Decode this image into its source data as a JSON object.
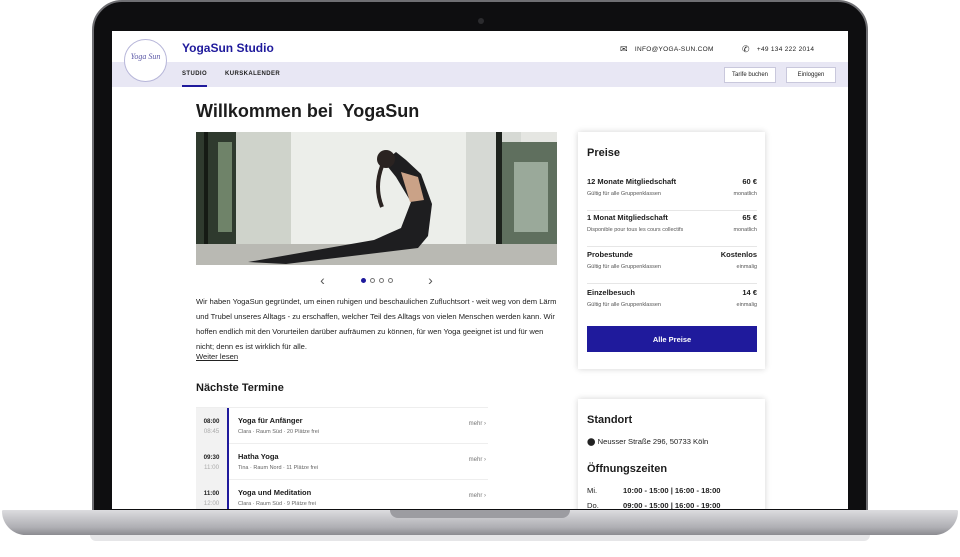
{
  "header": {
    "logo_text": "Yoga Sun",
    "brand": "YogaSun Studio",
    "email": "INFO@YOGA-SUN.COM",
    "phone": "+49 134 222 2014"
  },
  "nav": {
    "links": [
      "STUDIO",
      "KURSKALENDER"
    ],
    "btn_tarife": "Tarife buchen",
    "btn_login": "Einloggen"
  },
  "main": {
    "title": "Willkommen bei  YogaSun",
    "intro": "Wir haben YogaSun gegründet, um einen ruhigen und beschaulichen Zufluchtsort - weit weg von dem Lärm und Trubel unseres Alltags - zu erschaffen, welcher Teil des Alltags von vielen Menschen werden kann. Wir hoffen endlich mit den Vorurteilen darüber aufräumen zu können, für wen Yoga geeignet ist und für wen nicht; denn es ist wirklich für alle.",
    "read_more": "Weiter lesen",
    "carousel": {
      "slides": 4,
      "active": 1
    }
  },
  "schedule": {
    "title": "Nächste Termine",
    "more_label": "mehr",
    "items": [
      {
        "start": "08:00",
        "end": "08:45",
        "name": "Yoga für Anfänger",
        "desc": "Clara · Raum Süd · 20 Plätze frei"
      },
      {
        "start": "09:30",
        "end": "11:00",
        "name": "Hatha Yoga",
        "desc": "Tina · Raum Nord · 11 Plätze frei"
      },
      {
        "start": "11:00",
        "end": "12:00",
        "name": "Yoga und Meditation",
        "desc": "Clara · Raum Süd · 9 Plätze frei"
      }
    ]
  },
  "prices": {
    "title": "Preise",
    "items": [
      {
        "name": "12 Monate Mitgliedschaft",
        "value": "60 €",
        "note": "Gültig für alle Gruppenklassen",
        "period": "monatlich"
      },
      {
        "name": "1 Monat Mitgliedschaft",
        "value": "65 €",
        "note": "Disponible pour tous les cours collectifs",
        "period": "monatlich"
      },
      {
        "name": "Probestunde",
        "value": "Kostenlos",
        "note": "Gültig für alle Gruppenklassen",
        "period": "einmalig"
      },
      {
        "name": "Einzelbesuch",
        "value": "14 €",
        "note": "Gültig für alle Gruppenklassen",
        "period": "einmalig"
      }
    ],
    "button": "Alle Preise"
  },
  "location": {
    "title": "Standort",
    "address": "Neusser Straße 296, 50733 Köln",
    "hours_title": "Öffnungszeiten",
    "hours": [
      {
        "day": "Mi.",
        "time": "10:00 - 15:00 | 16:00 - 18:00"
      },
      {
        "day": "Do.",
        "time": "09:00 - 15:00 | 16:00 - 19:00"
      }
    ]
  },
  "colors": {
    "accent": "#1f1a9c",
    "nav_bg": "#e8e7f4"
  },
  "icons": [
    "mail-icon",
    "phone-icon",
    "map-pin-icon",
    "chevron-left-icon",
    "chevron-right-icon"
  ]
}
